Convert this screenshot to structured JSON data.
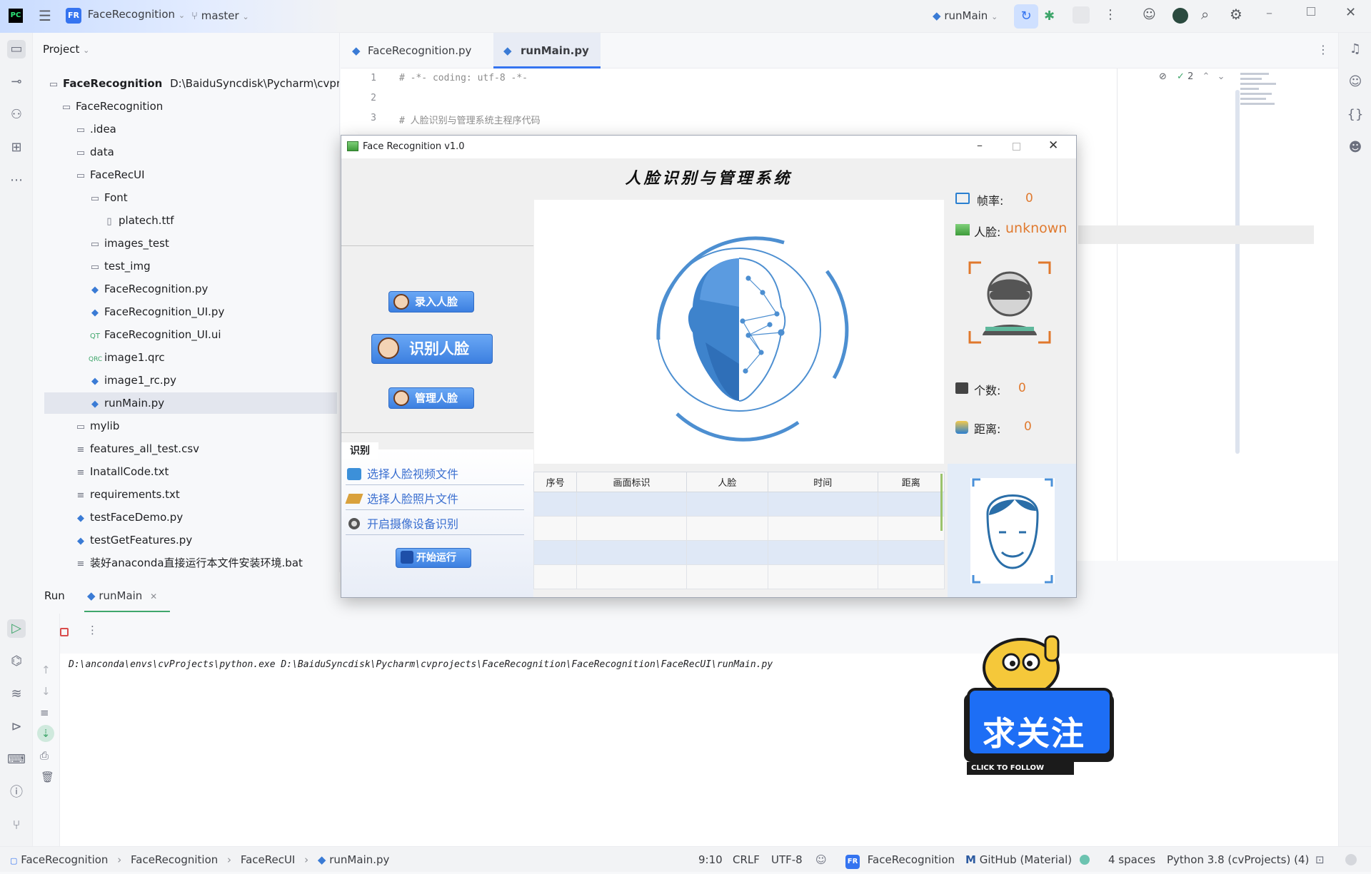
{
  "titlebar": {
    "project_badge": "FR",
    "project_name": "FaceRecognition",
    "branch": "master",
    "run_config": "runMain"
  },
  "project_panel": {
    "title": "Project",
    "items": [
      {
        "label": "FaceRecognition",
        "extra": "D:\\BaiduSyncdisk\\Pycharm\\cvproje",
        "type": "folder"
      },
      {
        "label": "FaceRecognition",
        "type": "folder"
      },
      {
        "label": ".idea",
        "type": "folder"
      },
      {
        "label": "data",
        "type": "folder"
      },
      {
        "label": "FaceRecUI",
        "type": "folder"
      },
      {
        "label": "Font",
        "type": "folder"
      },
      {
        "label": "platech.ttf",
        "type": "file"
      },
      {
        "label": "images_test",
        "type": "folder"
      },
      {
        "label": "test_img",
        "type": "folder"
      },
      {
        "label": "FaceRecognition.py",
        "type": "py"
      },
      {
        "label": "FaceRecognition_UI.py",
        "type": "py"
      },
      {
        "label": "FaceRecognition_UI.ui",
        "type": "qt"
      },
      {
        "label": "image1.qrc",
        "type": "qrc"
      },
      {
        "label": "image1_rc.py",
        "type": "py"
      },
      {
        "label": "runMain.py",
        "type": "py"
      },
      {
        "label": "mylib",
        "type": "folder"
      },
      {
        "label": "features_all_test.csv",
        "type": "text"
      },
      {
        "label": "InatallCode.txt",
        "type": "text"
      },
      {
        "label": "requirements.txt",
        "type": "text"
      },
      {
        "label": "testFaceDemo.py",
        "type": "py"
      },
      {
        "label": "testGetFeatures.py",
        "type": "py"
      },
      {
        "label": "装好anaconda直接运行本文件安装环境.bat",
        "type": "text"
      }
    ]
  },
  "editor": {
    "tabs": [
      {
        "label": "FaceRecognition.py"
      },
      {
        "label": "runMain.py"
      }
    ],
    "lines": [
      {
        "n": "1",
        "text": "# -*- coding: utf-8 -*-"
      },
      {
        "n": "2",
        "text": ""
      },
      {
        "n": "3",
        "text": "# 人脸识别与管理系统主程序代码"
      }
    ],
    "inspection_count": "2"
  },
  "app": {
    "window_title": "Face Recognition v1.0",
    "heading": "人脸识别与管理系统",
    "btn_enroll": "录入人脸",
    "btn_recognize": "识别人脸",
    "btn_manage": "管理人脸",
    "section_label": "识别",
    "link_video": "选择人脸视频文件",
    "link_photo": "选择人脸照片文件",
    "link_camera": "开启摄像设备识别",
    "btn_run": "开始运行",
    "fps_label": "帧率:",
    "fps_value": "0",
    "face_label": "人脸:",
    "face_value": "unknown",
    "count_label": "个数:",
    "count_value": "0",
    "dist_label": "距离:",
    "dist_value": "0",
    "table_headers": [
      "序号",
      "画面标识",
      "人脸",
      "时间",
      "距离"
    ]
  },
  "run_panel": {
    "title": "Run",
    "tab": "runMain",
    "console_line": "D:\\anconda\\envs\\cvProjects\\python.exe D:\\BaiduSyncdisk\\Pycharm\\cvprojects\\FaceRecognition\\FaceRecognition\\FaceRecUI\\runMain.py"
  },
  "sticker": {
    "text": "求关注",
    "sub": "CLICK TO FOLLOW"
  },
  "statusbar": {
    "crumbs": [
      "FaceRecognition",
      "FaceRecognition",
      "FaceRecUI",
      "runMain.py"
    ],
    "position": "9:10",
    "line_sep": "CRLF",
    "encoding": "UTF-8",
    "project_badge": "FR",
    "project": "FaceRecognition",
    "theme": "GitHub (Material)",
    "indent": "4 spaces",
    "interpreter": "Python 3.8 (cvProjects) (4)"
  },
  "colors": {
    "accent": "#3574f0",
    "app_value": "#e07a2f",
    "app_link": "#3a6fd0"
  }
}
